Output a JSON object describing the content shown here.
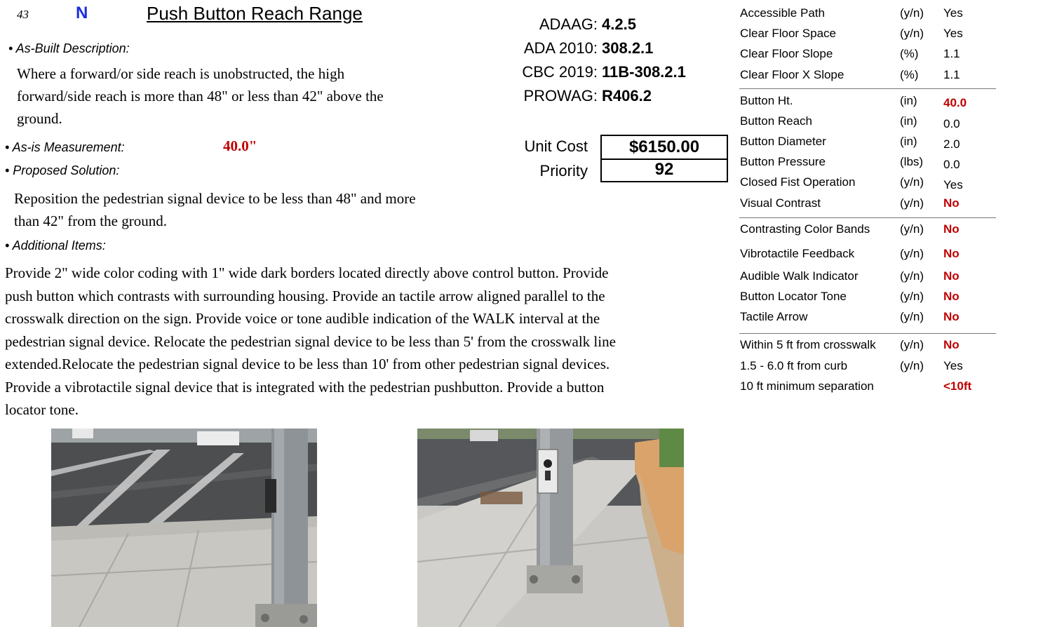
{
  "header": {
    "number": "43",
    "code_letter": "N",
    "title": "Push Button Reach Range"
  },
  "sections": {
    "as_built_label": "• As-Built Description:",
    "as_built_text_line1": "Where a forward/or side reach is unobstructed, the high",
    "as_built_text_line2": "forward/side reach is more than 48\" or less than 42\" above the",
    "as_built_text_line3": "ground.",
    "measurement_label": "• As-is Measurement:",
    "measurement_value": "40.0\"",
    "proposed_label": "• Proposed Solution:",
    "proposed_text_line1": "Reposition the pedestrian signal device to be less than 48\" and more",
    "proposed_text_line2": "than 42\" from the ground.",
    "additional_label": "• Additional Items:",
    "additional_lines": [
      "Provide 2\" wide color coding with 1\" wide dark borders located directly above control button. Provide",
      "push button which contrasts with surrounding housing. Provide an tactile arrow aligned parallel to the",
      "crosswalk direction on the sign. Provide voice or tone audible indication of the WALK interval at the",
      "pedestrian signal device. Relocate the pedestrian signal device to be less than 5' from the crosswalk line",
      "extended.Relocate the pedestrian signal device to be less than 10' from other pedestrian signal devices.",
      "Provide a vibrotactile signal device that is integrated with the pedestrian pushbutton. Provide a button",
      "locator tone."
    ]
  },
  "codes": [
    {
      "label": "ADAAG:",
      "value": "4.2.5"
    },
    {
      "label": "ADA 2010:",
      "value": "308.2.1"
    },
    {
      "label": "CBC 2019:",
      "value": "11B-308.2.1"
    },
    {
      "label": "PROWAG:",
      "value": "R406.2"
    }
  ],
  "cost": {
    "unit_cost_label": "Unit Cost",
    "unit_cost_value": "$6150.00",
    "priority_label": "Priority",
    "priority_value": "92"
  },
  "spec_table": [
    {
      "name": "Accessible Path",
      "unit": "(y/n)",
      "value": "Yes"
    },
    {
      "name": "Clear Floor Space",
      "unit": "(y/n)",
      "value": "Yes"
    },
    {
      "name": "Clear Floor Slope",
      "unit": "(%)",
      "value": "1.1"
    },
    {
      "name": "Clear Floor X Slope",
      "unit": "(%)",
      "value": "1.1"
    },
    {
      "name": "Button Ht.",
      "unit": "(in)",
      "value": "40.0"
    },
    {
      "name": "Button Reach",
      "unit": "(in)",
      "value": "0.0"
    },
    {
      "name": "Button Diameter",
      "unit": "(in)",
      "value": "2.0"
    },
    {
      "name": "Button Pressure",
      "unit": "(lbs)",
      "value": "0.0"
    },
    {
      "name": "Closed Fist Operation",
      "unit": "(y/n)",
      "value": "Yes"
    },
    {
      "name": "Visual Contrast",
      "unit": "(y/n)",
      "value": "No"
    },
    {
      "name": "Contrasting Color Bands",
      "unit": "(y/n)",
      "value": "No"
    },
    {
      "name": "Vibrotactile Feedback",
      "unit": "(y/n)",
      "value": "No"
    },
    {
      "name": "Audible Walk Indicator",
      "unit": "(y/n)",
      "value": "No"
    },
    {
      "name": "Button Locator Tone",
      "unit": "(y/n)",
      "value": "No"
    },
    {
      "name": "Tactile Arrow",
      "unit": "(y/n)",
      "value": "No"
    },
    {
      "name": "Within 5 ft from crosswalk",
      "unit": "(y/n)",
      "value": "No"
    },
    {
      "name": "1.5 - 6.0 ft from curb",
      "unit": "(y/n)",
      "value": "Yes"
    },
    {
      "name": "10 ft minimum separation",
      "unit": "",
      "value": "<10ft"
    }
  ],
  "colors": {
    "red_flag": "#c00000",
    "code_letter": "#1a2ee0"
  }
}
